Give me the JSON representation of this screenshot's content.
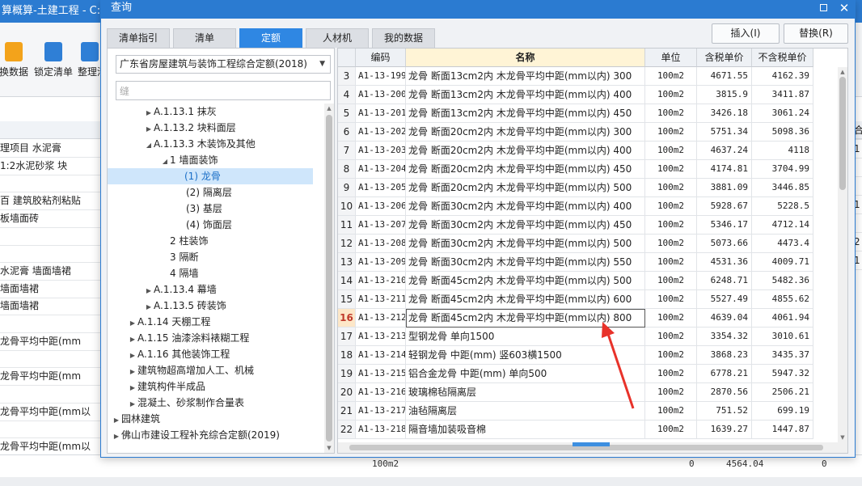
{
  "background_app": {
    "title": "算概算-土建工程 - C:/Us",
    "toolbar": [
      {
        "label": "换数据",
        "icon": "data-swap-icon"
      },
      {
        "label": "锁定清单",
        "icon": "lock-icon"
      },
      {
        "label": "整理清",
        "icon": "organize-icon"
      }
    ],
    "rows": [
      "理项目 水泥膏",
      " 1:2水泥砂浆 块",
      "",
      "百 建筑胶粘剂粘贴",
      "板墙面砖",
      "",
      "",
      "水泥膏 墙面墙裙",
      "墙面墙裙",
      "墙面墙裙",
      "",
      "龙骨平均中距(mm",
      "",
      "龙骨平均中距(mm",
      "",
      "龙骨平均中距(mm以",
      "",
      "龙骨平均中距(mm以"
    ],
    "right_edge": [
      "合",
      "1",
      "",
      "",
      "1",
      "",
      "2",
      "1"
    ],
    "bottom_unit": "100m2",
    "bottom_val1": "0",
    "bottom_val2": "4564.04",
    "bottom_val3": "0"
  },
  "dialog": {
    "title": "查询",
    "tabs": [
      "清单指引",
      "清单",
      "定额",
      "人材机",
      "我的数据"
    ],
    "active_tab": "定额",
    "insert_button": "插入(I)",
    "replace_button": "替换(R)",
    "quota_library": "广东省房屋建筑与装饰工程综合定额(2018)",
    "search_value": "缝",
    "tree": [
      {
        "label": "A.1.13.1 抹灰",
        "arrow": "▶"
      },
      {
        "label": "A.1.13.2 块料面层",
        "arrow": "▶"
      },
      {
        "label": "A.1.13.3 木装饰及其他",
        "arrow": "◢"
      },
      {
        "label": "1 墙面装饰",
        "arrow": "◢"
      },
      {
        "label": "(1) 龙骨",
        "arrow": "",
        "selected": true
      },
      {
        "label": "(2) 隔离层",
        "arrow": ""
      },
      {
        "label": "(3) 基层",
        "arrow": ""
      },
      {
        "label": "(4) 饰面层",
        "arrow": ""
      },
      {
        "label": "2 柱装饰",
        "arrow": ""
      },
      {
        "label": "3 隔断",
        "arrow": ""
      },
      {
        "label": "4 隔墙",
        "arrow": ""
      },
      {
        "label": "A.1.13.4 幕墙",
        "arrow": "▶"
      },
      {
        "label": "A.1.13.5 砖装饰",
        "arrow": "▶"
      },
      {
        "label": "A.1.14 天棚工程",
        "arrow": "▶"
      },
      {
        "label": "A.1.15 油漆涂料裱糊工程",
        "arrow": "▶"
      },
      {
        "label": "A.1.16 其他装饰工程",
        "arrow": "▶"
      },
      {
        "label": "建筑物超高增加人工、机械",
        "arrow": "▶"
      },
      {
        "label": "建筑构件半成品",
        "arrow": "▶"
      },
      {
        "label": "混凝土、砂浆制作合量表",
        "arrow": "▶"
      },
      {
        "label": "园林建筑",
        "arrow": "▶"
      },
      {
        "label": "佛山市建设工程补充综合定额(2019)",
        "arrow": "▶"
      }
    ],
    "grid_headers": {
      "code": "编码",
      "name": "名称",
      "unit": "单位",
      "tax_price": "含税单价",
      "notax_price": "不含税单价"
    },
    "rows": [
      {
        "n": "3",
        "code": "A1-13-199",
        "name": "龙骨 断面13cm2内 木龙骨平均中距(mm以内) 300",
        "unit": "100m2",
        "tax": "4671.55",
        "notax": "4162.39"
      },
      {
        "n": "4",
        "code": "A1-13-200",
        "name": "龙骨 断面13cm2内 木龙骨平均中距(mm以内) 400",
        "unit": "100m2",
        "tax": "3815.9",
        "notax": "3411.87"
      },
      {
        "n": "5",
        "code": "A1-13-201",
        "name": "龙骨 断面13cm2内 木龙骨平均中距(mm以内) 450",
        "unit": "100m2",
        "tax": "3426.18",
        "notax": "3061.24"
      },
      {
        "n": "6",
        "code": "A1-13-202",
        "name": "龙骨 断面20cm2内 木龙骨平均中距(mm以内) 300",
        "unit": "100m2",
        "tax": "5751.34",
        "notax": "5098.36"
      },
      {
        "n": "7",
        "code": "A1-13-203",
        "name": "龙骨 断面20cm2内 木龙骨平均中距(mm以内) 400",
        "unit": "100m2",
        "tax": "4637.24",
        "notax": "4118"
      },
      {
        "n": "8",
        "code": "A1-13-204",
        "name": "龙骨 断面20cm2内 木龙骨平均中距(mm以内) 450",
        "unit": "100m2",
        "tax": "4174.81",
        "notax": "3704.99"
      },
      {
        "n": "9",
        "code": "A1-13-205",
        "name": "龙骨 断面20cm2内 木龙骨平均中距(mm以内) 500",
        "unit": "100m2",
        "tax": "3881.09",
        "notax": "3446.85"
      },
      {
        "n": "10",
        "code": "A1-13-206",
        "name": "龙骨 断面30cm2内 木龙骨平均中距(mm以内) 400",
        "unit": "100m2",
        "tax": "5928.67",
        "notax": "5228.5"
      },
      {
        "n": "11",
        "code": "A1-13-207",
        "name": "龙骨 断面30cm2内 木龙骨平均中距(mm以内) 450",
        "unit": "100m2",
        "tax": "5346.17",
        "notax": "4712.14"
      },
      {
        "n": "12",
        "code": "A1-13-208",
        "name": "龙骨 断面30cm2内 木龙骨平均中距(mm以内) 500",
        "unit": "100m2",
        "tax": "5073.66",
        "notax": "4473.4"
      },
      {
        "n": "13",
        "code": "A1-13-209",
        "name": "龙骨 断面30cm2内 木龙骨平均中距(mm以内) 550",
        "unit": "100m2",
        "tax": "4531.36",
        "notax": "4009.71"
      },
      {
        "n": "14",
        "code": "A1-13-210",
        "name": "龙骨 断面45cm2内 木龙骨平均中距(mm以内) 500",
        "unit": "100m2",
        "tax": "6248.71",
        "notax": "5482.36"
      },
      {
        "n": "15",
        "code": "A1-13-211",
        "name": "龙骨 断面45cm2内 木龙骨平均中距(mm以内) 600",
        "unit": "100m2",
        "tax": "5527.49",
        "notax": "4855.62"
      },
      {
        "n": "16",
        "code": "A1-13-212",
        "name": "龙骨 断面45cm2内 木龙骨平均中距(mm以内) 800",
        "unit": "100m2",
        "tax": "4639.04",
        "notax": "4061.94",
        "highlight": true
      },
      {
        "n": "17",
        "code": "A1-13-213",
        "name": "型钢龙骨 单向1500",
        "unit": "100m2",
        "tax": "3354.32",
        "notax": "3010.61"
      },
      {
        "n": "18",
        "code": "A1-13-214",
        "name": "轻钢龙骨 中距(mm) 竖603横1500",
        "unit": "100m2",
        "tax": "3868.23",
        "notax": "3435.37"
      },
      {
        "n": "19",
        "code": "A1-13-215",
        "name": "铝合金龙骨 中距(mm) 单向500",
        "unit": "100m2",
        "tax": "6778.21",
        "notax": "5947.32"
      },
      {
        "n": "20",
        "code": "A1-13-216",
        "name": "玻璃棉毡隔离层",
        "unit": "100m2",
        "tax": "2870.56",
        "notax": "2506.21"
      },
      {
        "n": "21",
        "code": "A1-13-217",
        "name": "油毡隔离层",
        "unit": "100m2",
        "tax": "751.52",
        "notax": "699.19"
      },
      {
        "n": "22",
        "code": "A1-13-218",
        "name": "隔音墙加装吸音棉",
        "unit": "100m2",
        "tax": "1639.27",
        "notax": "1447.87"
      }
    ],
    "annotation_color": "#e8322a"
  }
}
